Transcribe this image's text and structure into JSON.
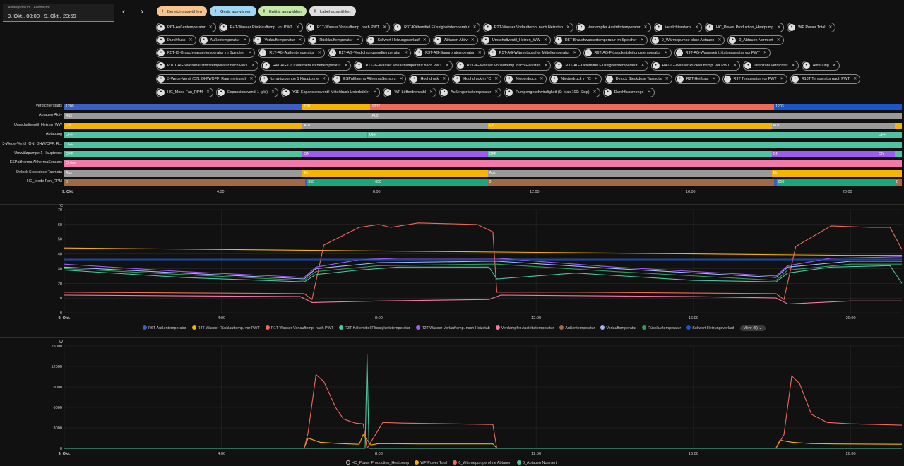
{
  "date_picker": {
    "label": "Anfangsdatum - Enddatum",
    "value": "9. Okt., 00:00 - 9. Okt., 23:59"
  },
  "nav": {
    "prev": "‹",
    "next": "›"
  },
  "target_buttons": [
    {
      "label": "Bereich auswählen",
      "color": "#f9c48b"
    },
    {
      "label": "Gerät auswählen",
      "color": "#9fd8f5"
    },
    {
      "label": "Entität auswählen",
      "color": "#c5e8a8"
    },
    {
      "label": "Label auswählen",
      "color": "#dedede"
    }
  ],
  "chip_rows": [
    [
      "R6T-Außentemperatur",
      "R4T-Wasser Rücklauftemp. vor PWT",
      "R1T-Wasser Vorlauftemp. nach PWT",
      "R3T-Kältemittel Flüssigkeitstemperatur",
      "R2T-Wasser Vorlauftemp. nach Heizstab",
      "Verdampfer Austrittstemperatur",
      "Verdichterstarts",
      "HC_Power Production_Heatpump",
      "WP Power Total"
    ],
    [
      "Durchfluss",
      "Außentemperatur",
      "Vorlauftemperatur",
      "Rücklauftemperatur",
      "Sollwert Heizungsvorlauf",
      "Abtauen Aktiv",
      "Umschaltventil_Heizen_WW",
      "R5T-Brauchwassertemperatur im Speicher",
      "0_Wärmepumpe ohne Abtauen",
      "0_Abtauen Normiert"
    ],
    [
      "R5T-IG-Brauchwassertemperatur im Speicher",
      "R1T-AG-Außentemperatur",
      "R2T-AG-Verdichtungsendtemperatur",
      "R3T-AG-Saugrohrtemperatur",
      "R5T-AG-Wärmetauscher Mitteltemperatur",
      "R6T-AG-Flüssigkeitsleitungstemperatur",
      "R9T-AG-Wassereintrittstemperatur vor PWT"
    ],
    [
      "R10T-AG-Wasseraustrittstemperatur nach PWT",
      "R4T-AG-O/U Wärmetauschertemperatur",
      "R1T-IG-Wasser Vorlauftemperatur nach PWT",
      "R2T-IG-Wasser Vorlauftemp. nach Heizstab",
      "R3T-AG-Kältemittel Flüssigkeitstemperatur",
      "R4T-IG-Wasser Rücklauftemp. vor PWT",
      "Drehzahl Verdichter",
      "Abtauung"
    ],
    [
      "3-Wege-Ventil (ON: DHW/OFF: Raumheizung)",
      "Umwälzpumpe 1 Hauptzone",
      "ESPaltherma AlthermaSensors",
      "Hochdruck",
      "Hochdruck in °C",
      "Niederdruck",
      "Niederdruck in °C",
      "Delock Steckdose Tasmota",
      "R2T-Heißgas",
      "R9T Temperatur vor PWT",
      "R10T Temperatur nach PWT"
    ],
    [
      "HC_Mode Fan_RPM",
      "Expansionsventil 1 (pls)",
      "Y1E-Expansionsventil Mitteldruck Unterkühler",
      "WP Lüfterdrehzahl",
      "Außengerätetemperatur",
      "Pumpengeschwindigkeit (0: Max-100: Stop)",
      "Durchflussmenge"
    ]
  ],
  "timeline": {
    "rows": [
      {
        "label": "Verdichterstarts",
        "segments": [
          {
            "from": 0,
            "to": 0.2845,
            "text": "1200",
            "color": "#3b5fc4"
          },
          {
            "from": 0.2845,
            "to": 0.3655,
            "text": "1201",
            "color": "#f4b400"
          },
          {
            "from": 0.3655,
            "to": 0.8475,
            "text": "1202",
            "color": "#f06a5a"
          },
          {
            "from": 0.8475,
            "to": 1.0,
            "text": "1203",
            "color": "#1b56c9"
          }
        ]
      },
      {
        "label": "Abtauen Aktiv",
        "segments": [
          {
            "from": 0,
            "to": 0.3655,
            "text": "Aus",
            "color": "#9a9a9a"
          },
          {
            "from": 0.3655,
            "to": 1.0,
            "text": "Aus",
            "color": "#9a9a9a"
          }
        ]
      },
      {
        "label": "Umschaltventil_Heizen_WW",
        "segments": [
          {
            "from": 0,
            "to": 0.2845,
            "text": "Ein",
            "color": "#f4b400"
          },
          {
            "from": 0.2845,
            "to": 0.5055,
            "text": "Aus",
            "color": "#9a9a9a"
          },
          {
            "from": 0.5055,
            "to": 0.8445,
            "text": "Ein",
            "color": "#f4b400"
          },
          {
            "from": 0.8445,
            "to": 0.9915,
            "text": "Aus",
            "color": "#9a9a9a"
          },
          {
            "from": 0.9915,
            "to": 1.0,
            "text": "",
            "color": "#f4b400"
          }
        ]
      },
      {
        "label": "Abtauung",
        "segments": [
          {
            "from": 0,
            "to": 0.3608,
            "text": "OFF",
            "color": "#4fc3a1"
          },
          {
            "from": 0.3608,
            "to": 0.3625,
            "text": "",
            "color": "#9c5cf0"
          },
          {
            "from": 0.3625,
            "to": 0.9705,
            "text": "OFF",
            "color": "#4fc3a1"
          },
          {
            "from": 0.9705,
            "to": 1.0,
            "text": "OFF",
            "color": "#4fc3a1"
          }
        ]
      },
      {
        "label": "3-Wege-Ventil (ON: DHW/OFF: R...",
        "segments": [
          {
            "from": 0,
            "to": 1.0,
            "text": "OFF",
            "color": "#4fc3a1"
          }
        ]
      },
      {
        "label": "Umwälzpumpe 1 Hauptzone",
        "segments": [
          {
            "from": 0,
            "to": 0.2845,
            "text": "OFF",
            "color": "#4fc3a1"
          },
          {
            "from": 0.2845,
            "to": 0.5055,
            "text": "ON",
            "color": "#9c5cf0"
          },
          {
            "from": 0.5055,
            "to": 0.8445,
            "text": "OFF",
            "color": "#4fc3a1"
          },
          {
            "from": 0.8445,
            "to": 0.9705,
            "text": "ON",
            "color": "#9c5cf0"
          },
          {
            "from": 0.9705,
            "to": 0.9915,
            "text": "ON",
            "color": "#9c5cf0"
          },
          {
            "from": 0.9915,
            "to": 1.0,
            "text": "",
            "color": "#4fc3a1"
          }
        ]
      },
      {
        "label": "ESPaltherma AlthermaSensors",
        "segments": [
          {
            "from": 0,
            "to": 1.0,
            "text": "Online",
            "color": "#f27aa8"
          }
        ]
      },
      {
        "label": "Delock Steckdose Tasmota",
        "segments": [
          {
            "from": 0,
            "to": 0.2845,
            "text": "Aus",
            "color": "#9a9a9a"
          },
          {
            "from": 0.2845,
            "to": 0.5055,
            "text": "Ein",
            "color": "#f4b400"
          },
          {
            "from": 0.5055,
            "to": 0.8445,
            "text": "Aus",
            "color": "#9a9a9a"
          },
          {
            "from": 0.8445,
            "to": 1.0,
            "text": "Ein",
            "color": "#f4b400"
          }
        ]
      },
      {
        "label": "HC_Mode Fan_RPM",
        "segments": [
          {
            "from": 0,
            "to": 0.2875,
            "text": "0",
            "color": "#a06a48"
          },
          {
            "from": 0.2875,
            "to": 0.2895,
            "text": "",
            "color": "#3b5fc4"
          },
          {
            "from": 0.2895,
            "to": 0.3695,
            "text": "650",
            "color": "#1aa87a"
          },
          {
            "from": 0.3695,
            "to": 0.5055,
            "text": "650",
            "color": "#1aa87a"
          },
          {
            "from": 0.5055,
            "to": 0.8475,
            "text": "0",
            "color": "#a06a48"
          },
          {
            "from": 0.8475,
            "to": 0.8505,
            "text": "",
            "color": "#3b5fc4"
          },
          {
            "from": 0.8505,
            "to": 0.9915,
            "text": "650",
            "color": "#1aa87a"
          },
          {
            "from": 0.9915,
            "to": 1.0,
            "text": "0",
            "color": "#a06a48"
          }
        ]
      }
    ],
    "x_ticks": [
      "9. Okt.",
      "4:00",
      "8:00",
      "12:00",
      "16:00",
      "20:00"
    ]
  },
  "chart_data": [
    {
      "type": "line",
      "unit": "°C",
      "ylim": [
        0,
        70
      ],
      "y_ticks": [
        0,
        10,
        20,
        30,
        40,
        50,
        60,
        70
      ],
      "x_ticks": [
        "9. Okt.",
        "4:00",
        "8:00",
        "12:00",
        "16:00",
        "20:00"
      ],
      "x_range_hours": [
        0,
        21.3
      ],
      "series": [
        {
          "name": "R6T-Außentemperatur",
          "color": "#3b5fc4",
          "x": [
            0,
            21.3
          ],
          "y": [
            37,
            37
          ]
        },
        {
          "name": "R4T-Wasser Rücklauftemp. vor PWT",
          "color": "#f4b400",
          "x": [
            0,
            4,
            8,
            12,
            16,
            20,
            21.3
          ],
          "y": [
            44,
            43,
            42,
            41,
            40,
            39,
            39
          ]
        },
        {
          "name": "R1T-Wasser Vorlauftemp. nach PWT",
          "color": "#f06a5a",
          "x": [
            0,
            6.1,
            6.3,
            6.6,
            7.5,
            8.0,
            8.3,
            9.0,
            10.5,
            10.9,
            11.0,
            13,
            18.1,
            18.3,
            18.6,
            19.5,
            20.5,
            21.0,
            21.3
          ],
          "y": [
            14,
            13,
            9,
            46,
            58,
            60,
            58,
            61,
            60,
            55,
            14,
            14,
            13,
            9,
            45,
            59,
            58,
            58,
            43
          ]
        },
        {
          "name": "R3T-Kältemittel Flüssigkeitstemperatur",
          "color": "#4fc3a1",
          "x": [
            0,
            3,
            6.1,
            6.4,
            7.5,
            8.5,
            10.8,
            11.0,
            13,
            16,
            18.1,
            18.4,
            19.5,
            21.0,
            21.3
          ],
          "y": [
            29,
            24,
            21,
            26,
            29,
            31,
            31,
            23,
            27,
            22,
            21,
            27,
            31,
            32,
            20
          ]
        },
        {
          "name": "R2T-Wasser Vorlauftemp. nach Heizstab",
          "color": "#9c5cf0",
          "x": [
            0,
            3,
            6.1,
            6.4,
            7.5,
            8.5,
            10.8,
            11.0,
            14,
            18.1,
            18.4,
            19.5,
            21.3
          ],
          "y": [
            33,
            28,
            24,
            31,
            36,
            37,
            37,
            37,
            31,
            25,
            32,
            37,
            38
          ]
        },
        {
          "name": "Verdampfer Austrittstemperatur",
          "color": "#f27aa8",
          "x": [
            0,
            6,
            6.3,
            8,
            10.8,
            11.1,
            16,
            18.1,
            18.4,
            20,
            21.3
          ],
          "y": [
            12,
            11,
            7,
            8,
            9,
            12,
            11,
            10,
            6,
            8,
            8
          ]
        },
        {
          "name": "Außentemperatur",
          "color": "#a06a48",
          "x": [
            0,
            21.3
          ],
          "y": [
            36,
            36
          ]
        },
        {
          "name": "Vorlauftemperatur",
          "color": "#9fb8f5",
          "x": [
            0,
            3,
            6.1,
            6.4,
            8,
            10.8,
            11.0,
            14,
            18.1,
            18.4,
            20,
            21.3
          ],
          "y": [
            31,
            27,
            23,
            30,
            34,
            35,
            35,
            30,
            24,
            31,
            35,
            35
          ]
        },
        {
          "name": "Rücklauftemperatur",
          "color": "#2e9e5e",
          "x": [
            0,
            3,
            6.1,
            6.4,
            8,
            10.8,
            11.0,
            14,
            18.1,
            18.4,
            20,
            21.3
          ],
          "y": [
            30,
            26,
            22,
            28,
            32,
            33,
            33,
            28,
            22,
            29,
            33,
            33
          ]
        },
        {
          "name": "Sollwert Heizungsvorlauf",
          "color": "#1b56c9",
          "x": [
            0,
            21.3
          ],
          "y": [
            36,
            36
          ]
        }
      ],
      "legend_more": "Mehr (5)"
    },
    {
      "type": "line",
      "unit": "W",
      "ylim": [
        0,
        15000
      ],
      "y_ticks": [
        0,
        3000,
        6000,
        9000,
        12000,
        15000
      ],
      "x_ticks": [
        "9. Okt.",
        "4:00",
        "8:00",
        "12:00",
        "16:00",
        "20:00"
      ],
      "x_range_hours": [
        0,
        21.3
      ],
      "series": [
        {
          "name": "HC_Power Production_Heatpump",
          "color": "#1a1a1a",
          "x": [
            0,
            21.3
          ],
          "y": [
            0,
            0
          ]
        },
        {
          "name": "WP Power Total",
          "color": "#f4b400",
          "x": [
            0,
            6.1,
            6.2,
            6.5,
            7.0,
            7.5,
            7.6,
            7.8,
            8.0,
            9,
            10.9,
            11.0,
            18.1,
            18.2,
            18.5,
            19.0,
            19.6,
            21.3
          ],
          "y": [
            50,
            50,
            1500,
            900,
            700,
            600,
            2000,
            500,
            700,
            650,
            650,
            50,
            50,
            1200,
            900,
            700,
            650,
            600
          ]
        },
        {
          "name": "0_Wärmepumpe ohne Abtauen",
          "color": "#f06a5a",
          "x": [
            0,
            6.1,
            6.2,
            6.4,
            6.6,
            6.9,
            7.1,
            7.4,
            7.6,
            7.7,
            8.1,
            8.6,
            10.9,
            11.0,
            18.1,
            18.3,
            18.5,
            18.7,
            19.0,
            19.4,
            20,
            21.3
          ],
          "y": [
            0,
            0,
            2300,
            10800,
            9800,
            6000,
            4300,
            3700,
            3600,
            0,
            3800,
            3700,
            3500,
            0,
            0,
            2000,
            10600,
            9500,
            5000,
            3800,
            3600,
            3400
          ]
        },
        {
          "name": "0_Abtauen Normiert",
          "color": "#4fc3a1",
          "x": [
            0,
            7.65,
            7.7,
            7.75,
            7.8,
            21.3
          ],
          "y": [
            0,
            0,
            13800,
            0,
            0,
            0
          ]
        }
      ]
    }
  ]
}
